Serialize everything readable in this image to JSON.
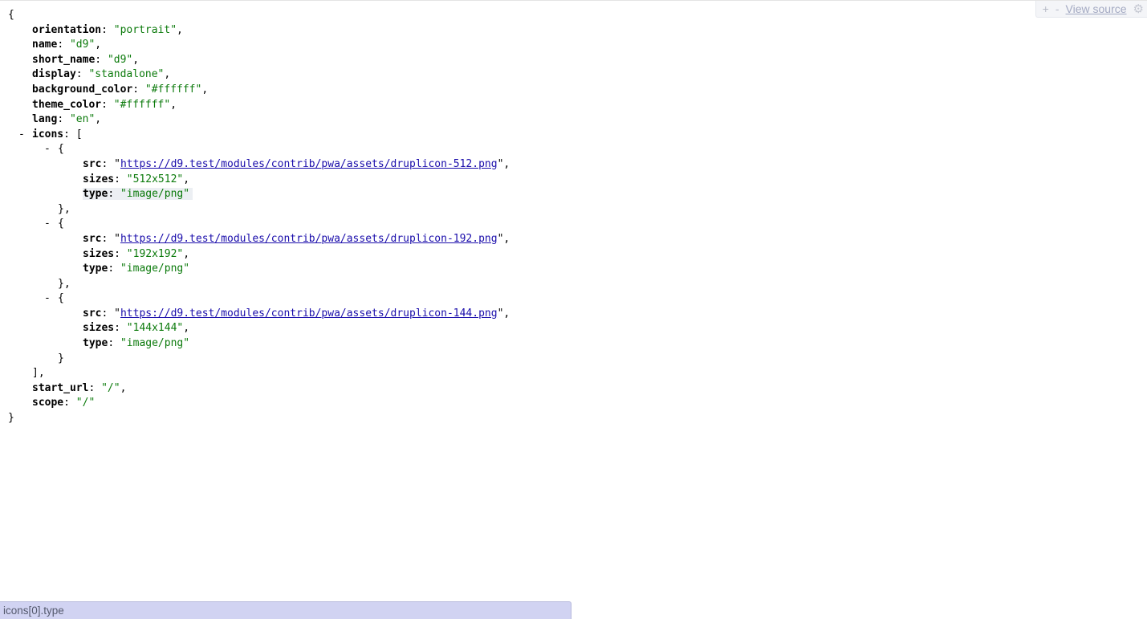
{
  "toolbar": {
    "plus": "+",
    "minus": "-",
    "view_source": "View source",
    "gear_icon": "gear-icon"
  },
  "status_bar": {
    "path": "icons[0].type"
  },
  "json": {
    "open_brace": "{",
    "close_brace": "}",
    "orientation": {
      "key": "orientation",
      "value": "\"portrait\""
    },
    "name": {
      "key": "name",
      "value": "\"d9\""
    },
    "short_name": {
      "key": "short_name",
      "value": "\"d9\""
    },
    "display": {
      "key": "display",
      "value": "\"standalone\""
    },
    "background_color": {
      "key": "background_color",
      "value": "\"#ffffff\""
    },
    "theme_color": {
      "key": "theme_color",
      "value": "\"#ffffff\""
    },
    "lang": {
      "key": "lang",
      "value": "\"en\""
    },
    "icons_key": "icons",
    "icons": [
      {
        "src_key": "src",
        "src": "https://d9.test/modules/contrib/pwa/assets/druplicon-512.png",
        "sizes_key": "sizes",
        "sizes": "\"512x512\"",
        "type_key": "type",
        "type": "\"image/png\""
      },
      {
        "src_key": "src",
        "src": "https://d9.test/modules/contrib/pwa/assets/druplicon-192.png",
        "sizes_key": "sizes",
        "sizes": "\"192x192\"",
        "type_key": "type",
        "type": "\"image/png\""
      },
      {
        "src_key": "src",
        "src": "https://d9.test/modules/contrib/pwa/assets/druplicon-144.png",
        "sizes_key": "sizes",
        "sizes": "\"144x144\"",
        "type_key": "type",
        "type": "\"image/png\""
      }
    ],
    "start_url": {
      "key": "start_url",
      "value": "\"/\""
    },
    "scope": {
      "key": "scope",
      "value": "\"/\""
    }
  },
  "colors": {
    "string": "#0b7a0b",
    "link": "#1a0dab",
    "status_bar_bg": "#d1d3f2",
    "hover_bg": "#eceff3"
  }
}
